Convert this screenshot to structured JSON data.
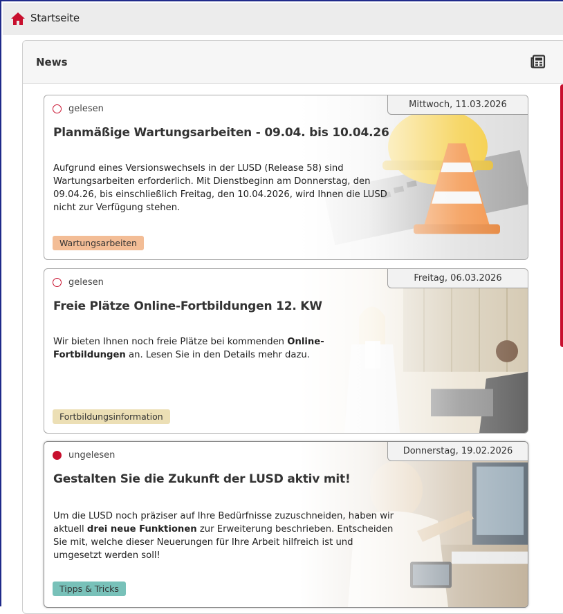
{
  "breadcrumb": {
    "label": "Startseite"
  },
  "panel": {
    "title": "News"
  },
  "colors": {
    "accent": "#c8102e",
    "header_bg": "#ececec"
  },
  "news": [
    {
      "status": "gelesen",
      "date": "Mittwoch, 11.03.2026",
      "title": "Planmäßige Wartungsarbeiten - 09.04. bis 10.04.26",
      "text": "Aufgrund eines Versionswechsels in der LUSD (Release 58) sind Wartungsarbeiten erforderlich. Mit Dienstbeginn am Donnerstag, den 09.04.26, bis einschließlich Freitag, den 10.04.2026, wird Ihnen die LUSD nicht zur Verfügung stehen.",
      "tag": "Wartungsarbeiten"
    },
    {
      "status": "gelesen",
      "date": "Freitag, 06.03.2026",
      "title": "Freie Plätze Online-Fortbildungen 12. KW",
      "text_parts": [
        "Wir bieten Ihnen noch freie Plätze bei kommenden ",
        "Online-Fortbildungen",
        " an. Lesen Sie in den Details mehr dazu."
      ],
      "tag": "Fortbildungsinformation"
    },
    {
      "status": "ungelesen",
      "date": "Donnerstag, 19.02.2026",
      "title": "Gestalten Sie die Zukunft der LUSD aktiv mit!",
      "text_parts": [
        "Um die LUSD noch präziser auf Ihre Bedürfnisse zuzuschneiden, haben wir aktuell ",
        "drei neue Funktionen",
        " zur Erweiterung beschrieben. Entscheiden Sie mit, welche dieser Neuerungen für Ihre Arbeit hilfreich ist und umgesetzt werden soll!"
      ],
      "tag": "Tipps & Tricks"
    }
  ]
}
